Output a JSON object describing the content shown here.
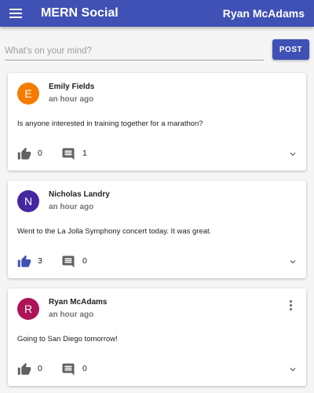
{
  "appbar": {
    "title": "MERN Social",
    "user": "Ryan McAdams",
    "menu_icon": "menu-icon",
    "color": "#3f51b5"
  },
  "composer": {
    "placeholder": "What's on your mind?",
    "post_label": "POST"
  },
  "posts": [
    {
      "author": "Emily Fields",
      "initial": "E",
      "avatar_color": "#f57c00",
      "time": "an hour ago",
      "text": "Is anyone interested in training together for a marathon?",
      "likes": "0",
      "liked": false,
      "comments": "1",
      "has_menu": false
    },
    {
      "author": "Nicholas Landry",
      "initial": "N",
      "avatar_color": "#4527a0",
      "time": "an hour ago",
      "text": "Went to the La Jolla Symphony concert today. It was great.",
      "likes": "3",
      "liked": true,
      "comments": "0",
      "has_menu": false
    },
    {
      "author": "Ryan McAdams",
      "initial": "R",
      "avatar_color": "#ad1457",
      "time": "an hour ago",
      "text": "Going to San Diego tomorrow!",
      "likes": "0",
      "liked": false,
      "comments": "0",
      "has_menu": true
    }
  ],
  "icons": {
    "like": "thumb-up-icon",
    "comment": "comment-icon",
    "expand": "chevron-down-icon",
    "more": "more-vert-icon"
  },
  "colors": {
    "liked": "#3f51b5",
    "unliked": "#616161"
  }
}
